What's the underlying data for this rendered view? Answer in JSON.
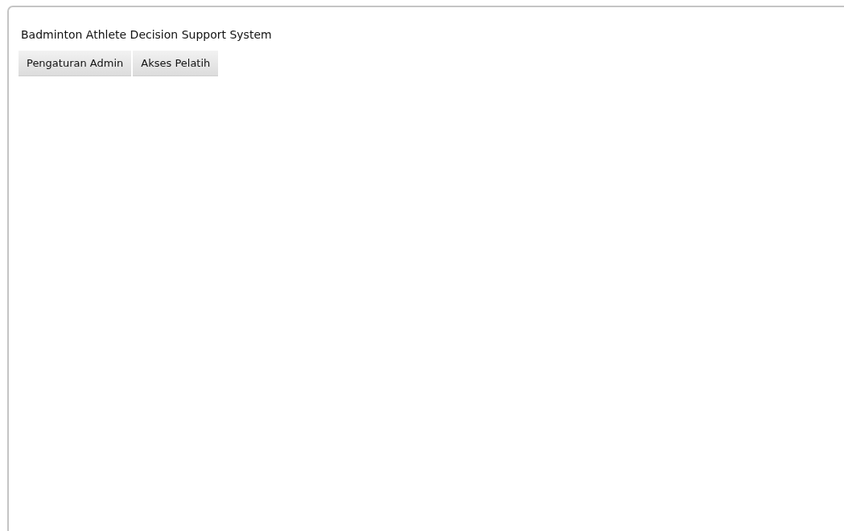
{
  "app": {
    "title": "Badminton Athlete Decision Support System"
  },
  "buttons": [
    "Pengaturan Admin",
    "Akses Pelatih"
  ]
}
